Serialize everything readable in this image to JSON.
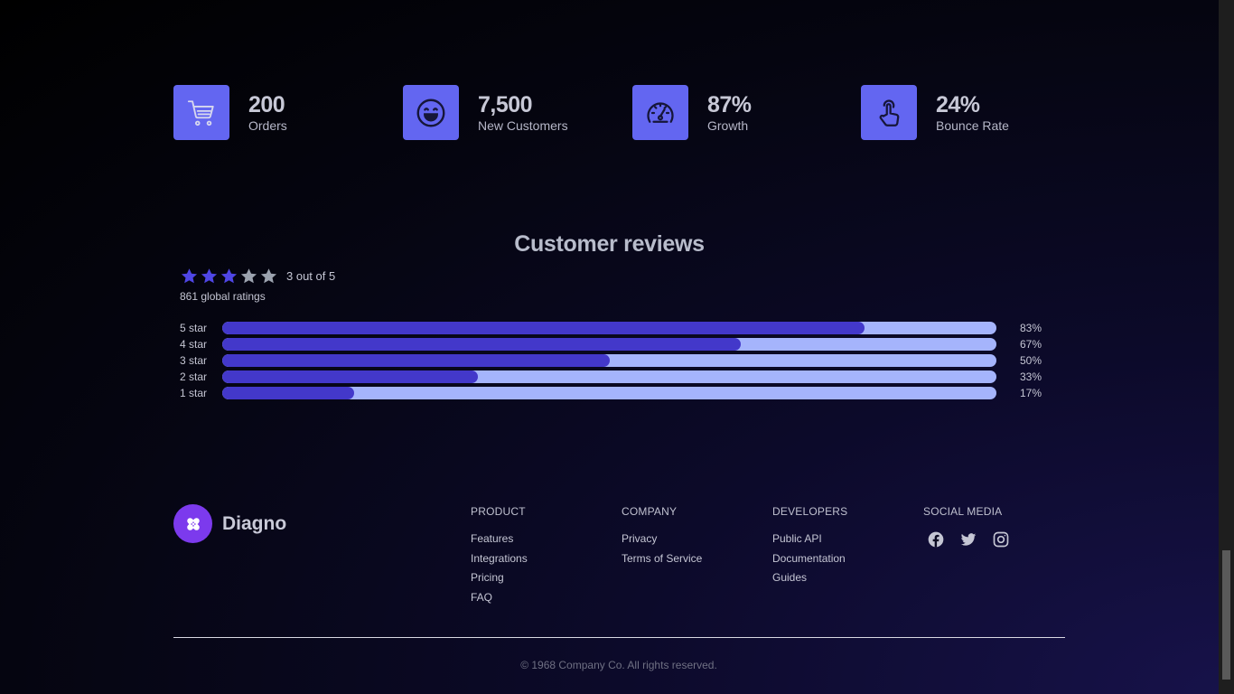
{
  "stats": [
    {
      "value": "200",
      "label": "Orders",
      "icon": "cart-icon"
    },
    {
      "value": "7,500",
      "label": "New Customers",
      "icon": "smile-icon"
    },
    {
      "value": "87%",
      "label": "Growth",
      "icon": "gauge-icon"
    },
    {
      "value": "24%",
      "label": "Bounce Rate",
      "icon": "pointer-hand-icon"
    }
  ],
  "reviews": {
    "title": "Customer reviews",
    "rating_value": 3,
    "rating_max": 5,
    "rating_text": "3 out of 5",
    "global_ratings": "861 global ratings",
    "bars": [
      {
        "label": "5 star",
        "percent": 83,
        "percent_text": "83%"
      },
      {
        "label": "4 star",
        "percent": 67,
        "percent_text": "67%"
      },
      {
        "label": "3 star",
        "percent": 50,
        "percent_text": "50%"
      },
      {
        "label": "2 star",
        "percent": 33,
        "percent_text": "33%"
      },
      {
        "label": "1 star",
        "percent": 17,
        "percent_text": "17%"
      }
    ]
  },
  "footer": {
    "brand": "Diagno",
    "columns": {
      "product": {
        "title": "PRODUCT",
        "links": [
          "Features",
          "Integrations",
          "Pricing",
          "FAQ"
        ]
      },
      "company": {
        "title": "COMPANY",
        "links": [
          "Privacy",
          "Terms of Service"
        ]
      },
      "developers": {
        "title": "DEVELOPERS",
        "links": [
          "Public API",
          "Documentation",
          "Guides"
        ]
      },
      "social": {
        "title": "SOCIAL MEDIA",
        "icons": [
          "facebook-icon",
          "twitter-icon",
          "instagram-icon"
        ]
      }
    },
    "copyright": "© 1968 Company Co. All rights reserved."
  },
  "colors": {
    "accent": "#6366f1",
    "bar_fill": "#4338ca",
    "bar_track": "#a5b4fc",
    "brand": "#7c3aed",
    "star_filled": "#4f46e5",
    "star_empty": "#9ca3af"
  }
}
